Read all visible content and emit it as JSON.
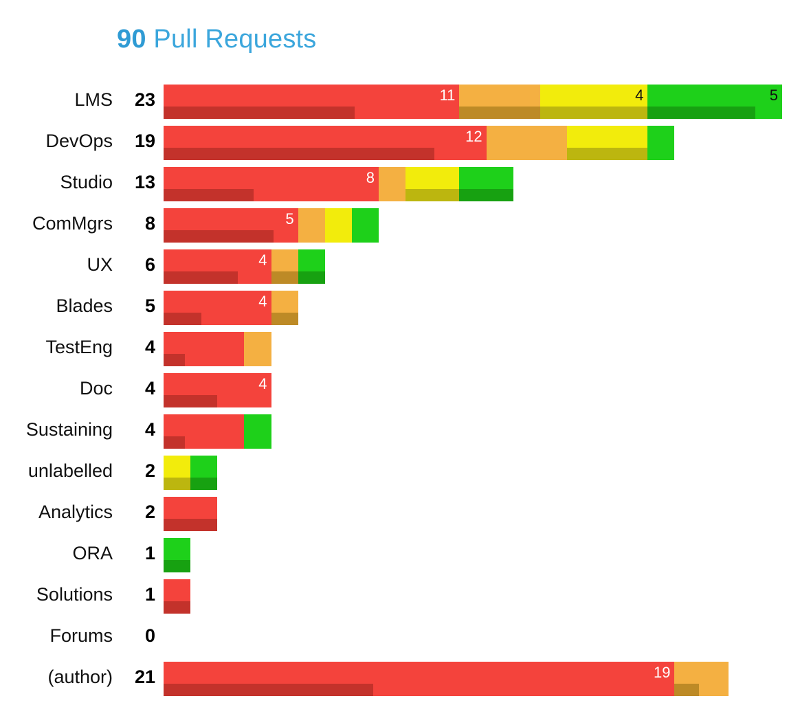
{
  "title": {
    "total": "90",
    "text": " Pull Requests",
    "color": "#3BA6DC"
  },
  "colors": {
    "red": "#F4433C",
    "red_dark": "#C3322B",
    "orange": "#F4B042",
    "orange_dark": "#BD8A26",
    "yellow": "#F2EC0C",
    "yellow_dark": "#BCB60F",
    "green": "#1ED01A",
    "green_dark": "#17A111",
    "background": "#FFFFFF",
    "label_text": "#111111"
  },
  "chart_data": {
    "type": "bar",
    "orientation": "horizontal",
    "stacked": true,
    "title": "90 Pull Requests",
    "xlabel": "",
    "ylabel": "",
    "grid": false,
    "legend": "none",
    "xlim": [
      0,
      25
    ],
    "series": [
      {
        "name": "red",
        "color": "#F4433C"
      },
      {
        "name": "orange",
        "color": "#F4B042"
      },
      {
        "name": "yellow",
        "color": "#F2EC0C"
      },
      {
        "name": "green",
        "color": "#1ED01A"
      }
    ],
    "categories": [
      "LMS",
      "DevOps",
      "Studio",
      "ComMgrs",
      "UX",
      "Blades",
      "TestEng",
      "Doc",
      "Sustaining",
      "unlabelled",
      "Analytics",
      "ORA",
      "Solutions",
      "Forums",
      "(author)"
    ],
    "totals": [
      23,
      19,
      13,
      8,
      6,
      5,
      4,
      4,
      4,
      2,
      2,
      1,
      1,
      0,
      21
    ],
    "rows": [
      {
        "label": "LMS",
        "count": "23",
        "segments": [
          {
            "series": "red",
            "value": 11,
            "label": "11",
            "label_color": "light",
            "sub_fraction": 0.645
          },
          {
            "series": "orange",
            "value": 3,
            "label": "",
            "label_color": "dark",
            "sub_fraction": 1.0
          },
          {
            "series": "yellow",
            "value": 4,
            "label": "4",
            "label_color": "dark",
            "sub_fraction": 1.0
          },
          {
            "series": "green",
            "value": 5,
            "label": "5",
            "label_color": "dark",
            "sub_fraction": 0.8
          }
        ]
      },
      {
        "label": "DevOps",
        "count": "19",
        "segments": [
          {
            "series": "red",
            "value": 12,
            "label": "12",
            "label_color": "light",
            "sub_fraction": 0.84
          },
          {
            "series": "orange",
            "value": 3,
            "label": "",
            "label_color": "dark",
            "sub_fraction": 0.0
          },
          {
            "series": "yellow",
            "value": 3,
            "label": "",
            "label_color": "dark",
            "sub_fraction": 1.0
          },
          {
            "series": "green",
            "value": 1,
            "label": "",
            "label_color": "dark",
            "sub_fraction": 0.0
          }
        ]
      },
      {
        "label": "Studio",
        "count": "13",
        "segments": [
          {
            "series": "red",
            "value": 8,
            "label": "8",
            "label_color": "light",
            "sub_fraction": 0.42
          },
          {
            "series": "orange",
            "value": 1,
            "label": "",
            "label_color": "dark",
            "sub_fraction": 0.0
          },
          {
            "series": "yellow",
            "value": 2,
            "label": "",
            "label_color": "dark",
            "sub_fraction": 1.0
          },
          {
            "series": "green",
            "value": 2,
            "label": "",
            "label_color": "dark",
            "sub_fraction": 1.0
          }
        ]
      },
      {
        "label": "ComMgrs",
        "count": "8",
        "segments": [
          {
            "series": "red",
            "value": 5,
            "label": "5",
            "label_color": "light",
            "sub_fraction": 0.82
          },
          {
            "series": "orange",
            "value": 1,
            "label": "",
            "label_color": "dark",
            "sub_fraction": 0.0
          },
          {
            "series": "yellow",
            "value": 1,
            "label": "",
            "label_color": "dark",
            "sub_fraction": 0.0
          },
          {
            "series": "green",
            "value": 1,
            "label": "",
            "label_color": "dark",
            "sub_fraction": 0.0
          }
        ]
      },
      {
        "label": "UX",
        "count": "6",
        "segments": [
          {
            "series": "red",
            "value": 4,
            "label": "4",
            "label_color": "light",
            "sub_fraction": 0.69
          },
          {
            "series": "orange",
            "value": 1,
            "label": "",
            "label_color": "dark",
            "sub_fraction": 1.0
          },
          {
            "series": "green",
            "value": 1,
            "label": "",
            "label_color": "dark",
            "sub_fraction": 1.0
          }
        ]
      },
      {
        "label": "Blades",
        "count": "5",
        "segments": [
          {
            "series": "red",
            "value": 4,
            "label": "4",
            "label_color": "light",
            "sub_fraction": 0.35
          },
          {
            "series": "orange",
            "value": 1,
            "label": "",
            "label_color": "dark",
            "sub_fraction": 1.0
          }
        ]
      },
      {
        "label": "TestEng",
        "count": "4",
        "segments": [
          {
            "series": "red",
            "value": 3,
            "label": "",
            "label_color": "light",
            "sub_fraction": 0.26
          },
          {
            "series": "orange",
            "value": 1,
            "label": "",
            "label_color": "dark",
            "sub_fraction": 0.0
          }
        ]
      },
      {
        "label": "Doc",
        "count": "4",
        "segments": [
          {
            "series": "red",
            "value": 4,
            "label": "4",
            "label_color": "light",
            "sub_fraction": 0.5
          }
        ]
      },
      {
        "label": "Sustaining",
        "count": "4",
        "segments": [
          {
            "series": "red",
            "value": 3,
            "label": "",
            "label_color": "light",
            "sub_fraction": 0.26
          },
          {
            "series": "green",
            "value": 1,
            "label": "",
            "label_color": "dark",
            "sub_fraction": 0.0
          }
        ]
      },
      {
        "label": "unlabelled",
        "count": "2",
        "segments": [
          {
            "series": "yellow",
            "value": 1,
            "label": "",
            "label_color": "dark",
            "sub_fraction": 1.0
          },
          {
            "series": "green",
            "value": 1,
            "label": "",
            "label_color": "dark",
            "sub_fraction": 1.0
          }
        ]
      },
      {
        "label": "Analytics",
        "count": "2",
        "segments": [
          {
            "series": "red",
            "value": 2,
            "label": "",
            "label_color": "light",
            "sub_fraction": 1.0
          }
        ]
      },
      {
        "label": "ORA",
        "count": "1",
        "segments": [
          {
            "series": "green",
            "value": 1,
            "label": "",
            "label_color": "dark",
            "sub_fraction": 1.0
          }
        ]
      },
      {
        "label": "Solutions",
        "count": "1",
        "segments": [
          {
            "series": "red",
            "value": 1,
            "label": "",
            "label_color": "light",
            "sub_fraction": 1.0
          }
        ]
      },
      {
        "label": "Forums",
        "count": "0",
        "segments": []
      },
      {
        "label": "(author)",
        "count": "21",
        "segments": [
          {
            "series": "red",
            "value": 19,
            "label": "19",
            "label_color": "light",
            "sub_fraction": 0.41
          },
          {
            "series": "orange",
            "value": 2,
            "label": "",
            "label_color": "dark",
            "sub_fraction": 0.45
          }
        ]
      }
    ]
  }
}
